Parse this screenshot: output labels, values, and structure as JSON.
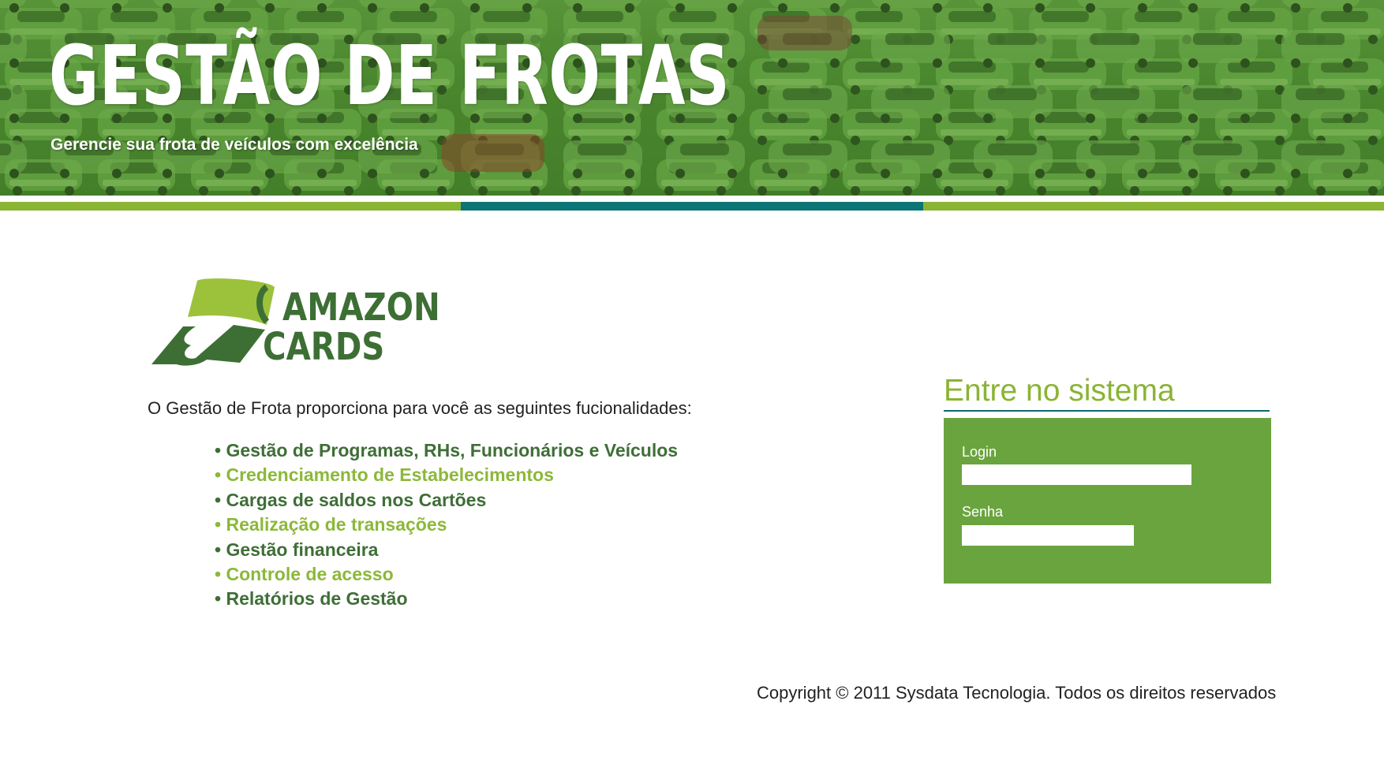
{
  "banner": {
    "title": "GESTÃO DE FROTAS",
    "subtitle": "Gerencie sua frota de veículos com excelência",
    "image": "green-tinted-parking-lot-of-cars"
  },
  "logo": {
    "line1": "AMAZON",
    "line2": "CARDS",
    "icon": "amazon-cards-logo-icon"
  },
  "intro": "O Gestão de Frota proporciona para você as seguintes fucionalidades:",
  "features": [
    "Gestão de Programas, RHs, Funcionários e Veículos",
    "Credenciamento de Estabelecimentos",
    "Cargas de saldos nos Cartões",
    "Realização de transações",
    "Gestão financeira",
    "Controle de acesso",
    "Relatórios de Gestão"
  ],
  "login": {
    "heading": "Entre no sistema",
    "login_label": "Login",
    "login_value": "",
    "password_label": "Senha",
    "password_value": ""
  },
  "footer": {
    "copyright": "Copyright © 2011 Sysdata Tecnologia. Todos os direitos reservados"
  },
  "colors": {
    "dark_green": "#3f6e37",
    "light_green": "#8cb83a",
    "teal": "#0d7575",
    "login_box": "#6aa43e"
  }
}
